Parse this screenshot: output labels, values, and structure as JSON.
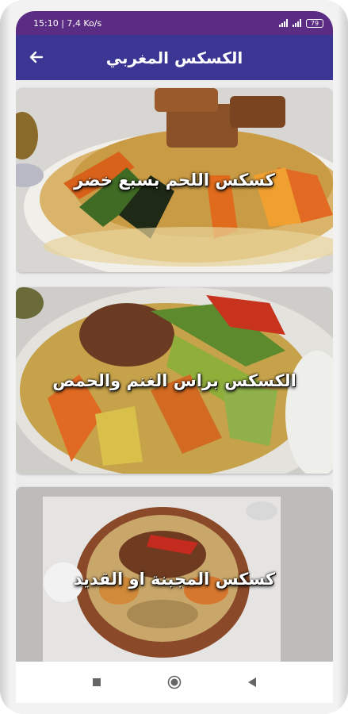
{
  "status_bar": {
    "time_speed": "15:10 | 7,4 Ko/s",
    "battery": "79"
  },
  "app_bar": {
    "title": "الكسكس المغربي",
    "back_icon": "arrow-left-icon"
  },
  "recipes": [
    {
      "label": "كسكس اللحم بسبع خضر"
    },
    {
      "label": "الكسكس براس الغنم والحمص"
    },
    {
      "label": "كسكس المجبنة او القديد"
    }
  ],
  "nav_bar": {
    "icons": [
      "square-icon",
      "circle-icon",
      "triangle-back-icon"
    ]
  },
  "colors": {
    "status_bar": "#5b2c83",
    "app_bar": "#3b3593",
    "text": "#ffffff"
  }
}
